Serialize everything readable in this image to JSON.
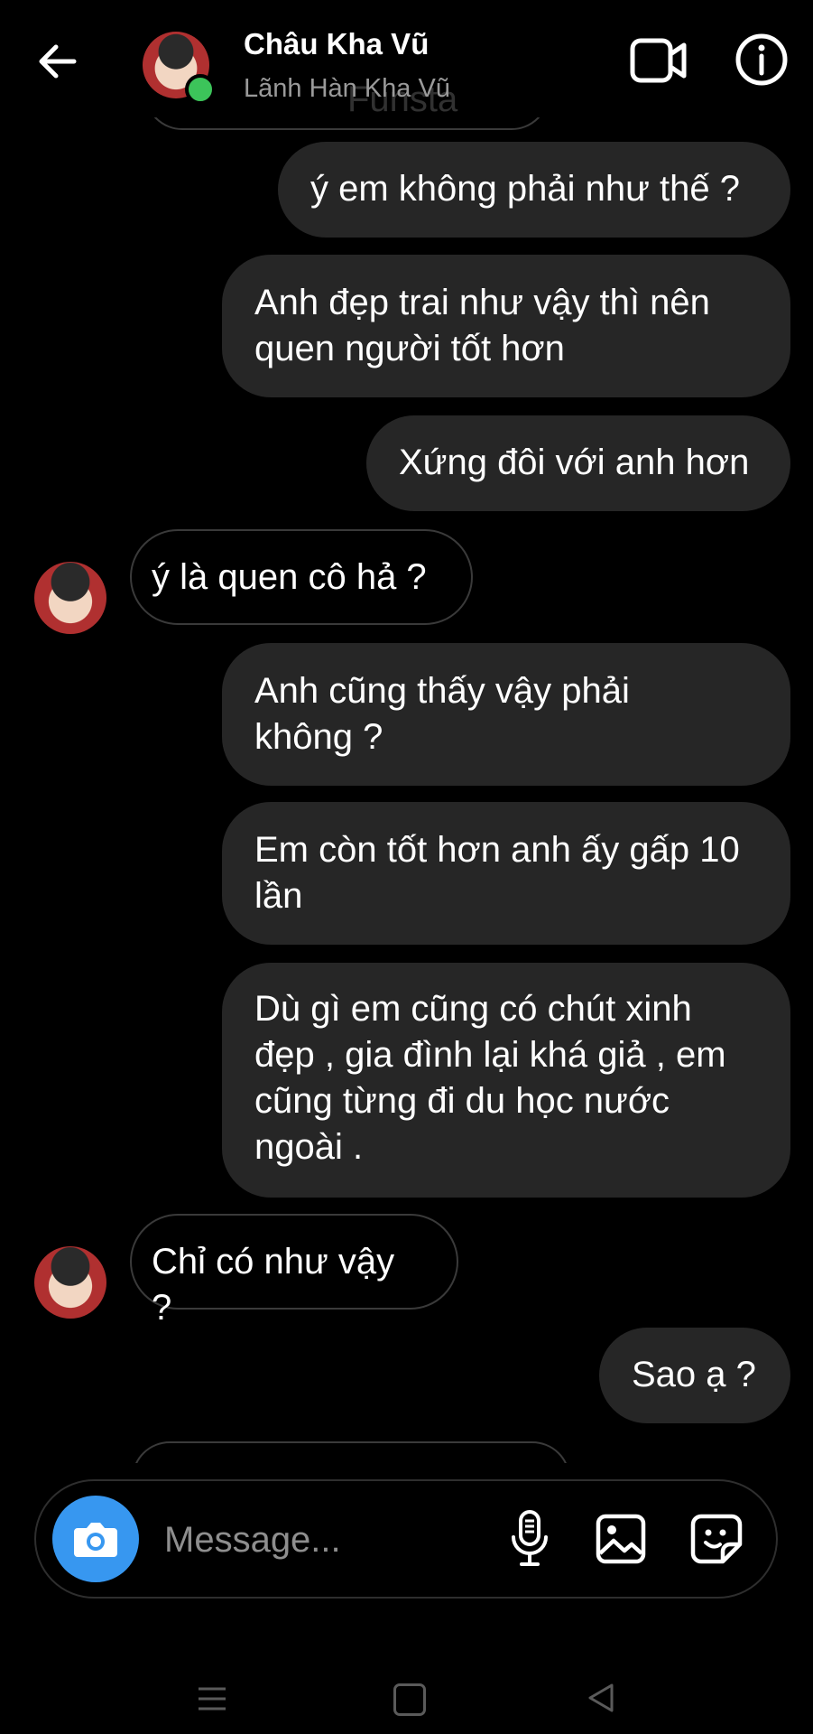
{
  "header": {
    "contact_name": "Châu Kha Vũ",
    "contact_subtitle": "Lãnh Hàn Kha Vũ",
    "watermark": "Funsta",
    "online_color": "#3cc45a"
  },
  "messages": [
    {
      "direction": "sent",
      "lines": [
        "ý em không phải như thế ?"
      ]
    },
    {
      "direction": "sent",
      "lines": [
        "Anh đẹp trai như vậy thì nên",
        "quen người tốt hơn"
      ]
    },
    {
      "direction": "sent",
      "lines": [
        "Xứng đôi với anh hơn"
      ]
    },
    {
      "direction": "received",
      "lines": [
        "ý là quen cô hả ?"
      ]
    },
    {
      "direction": "sent",
      "lines": [
        "Anh cũng thấy vậy phải",
        "không ?"
      ]
    },
    {
      "direction": "sent",
      "lines": [
        "Em còn tốt hơn anh ấy gấp 10",
        "lần"
      ]
    },
    {
      "direction": "sent",
      "lines": [
        "Dù gì em cũng có chút xinh",
        "đẹp , gia đình lại khá giả , em",
        "cũng từng đi du học nước",
        "ngoài ."
      ]
    },
    {
      "direction": "received",
      "lines": [
        "Chỉ có như vậy ?"
      ]
    },
    {
      "direction": "sent",
      "lines": [
        "Sao ạ ?"
      ]
    }
  ],
  "composer": {
    "placeholder": "Message...",
    "camera_color": "#3797f0"
  },
  "icons": {
    "back": "arrow-left-icon",
    "video": "video-camera-icon",
    "info": "info-icon",
    "camera": "camera-icon",
    "mic": "microphone-icon",
    "gallery": "image-icon",
    "sticker": "sticker-icon"
  },
  "colors": {
    "background": "#000000",
    "sent_bubble": "#262626",
    "received_border": "#3a3a3a"
  }
}
